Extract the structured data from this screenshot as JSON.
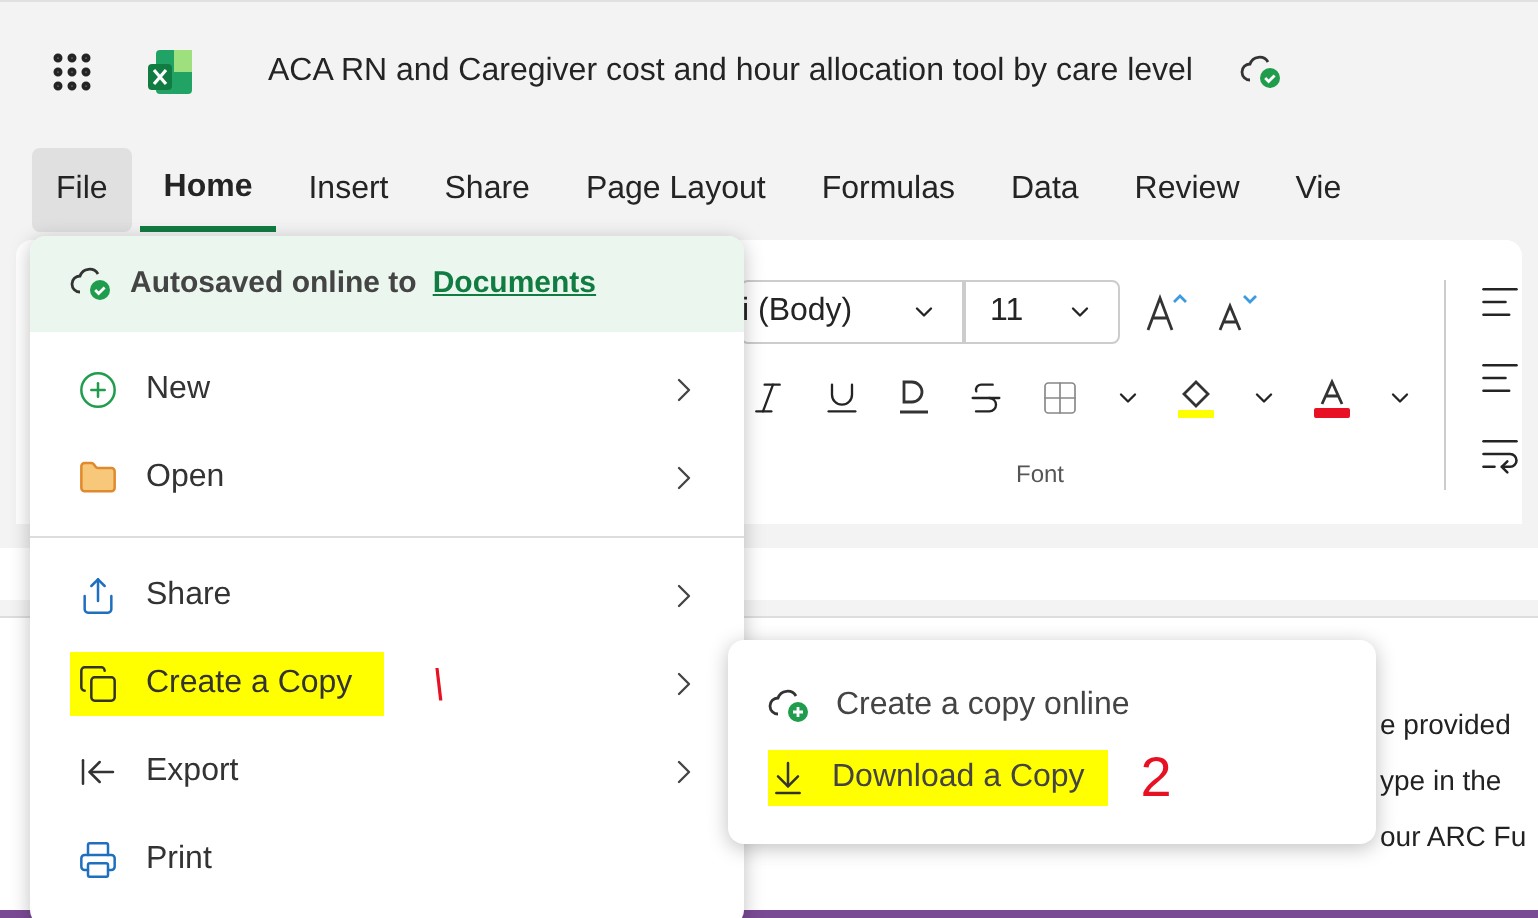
{
  "app": {
    "title": "ACA RN and Caregiver cost and hour allocation tool by care level"
  },
  "tabs": [
    {
      "label": "File",
      "selected": false,
      "open": true
    },
    {
      "label": "Home",
      "selected": true,
      "open": false
    },
    {
      "label": "Insert",
      "selected": false,
      "open": false
    },
    {
      "label": "Share",
      "selected": false,
      "open": false
    },
    {
      "label": "Page Layout",
      "selected": false,
      "open": false
    },
    {
      "label": "Formulas",
      "selected": false,
      "open": false
    },
    {
      "label": "Data",
      "selected": false,
      "open": false
    },
    {
      "label": "Review",
      "selected": false,
      "open": false
    },
    {
      "label": "Vie",
      "selected": false,
      "open": false
    }
  ],
  "ribbon": {
    "font_name": "i (Body)",
    "font_size": "11",
    "group_label": "Font"
  },
  "sheet": {
    "lines": [
      "e provided",
      "ype in the",
      "our ARC Fu"
    ]
  },
  "file_menu": {
    "banner": {
      "text": "Autosaved online to",
      "link": "Documents"
    },
    "groups": [
      [
        {
          "kind": "new",
          "label": "New",
          "has_submenu": true,
          "highlighted": false
        },
        {
          "kind": "open",
          "label": "Open",
          "has_submenu": true,
          "highlighted": false
        }
      ],
      [
        {
          "kind": "share",
          "label": "Share",
          "has_submenu": true,
          "highlighted": false
        },
        {
          "kind": "copy",
          "label": "Create a Copy",
          "has_submenu": true,
          "highlighted": true,
          "annotation": "\\"
        },
        {
          "kind": "export",
          "label": "Export",
          "has_submenu": true,
          "highlighted": false
        },
        {
          "kind": "print",
          "label": "Print",
          "has_submenu": false,
          "highlighted": false
        }
      ]
    ]
  },
  "submenu": {
    "items": [
      {
        "kind": "online",
        "label": "Create a copy online",
        "highlighted": false
      },
      {
        "kind": "download",
        "label": "Download a Copy",
        "highlighted": true,
        "annotation": "2"
      }
    ]
  }
}
